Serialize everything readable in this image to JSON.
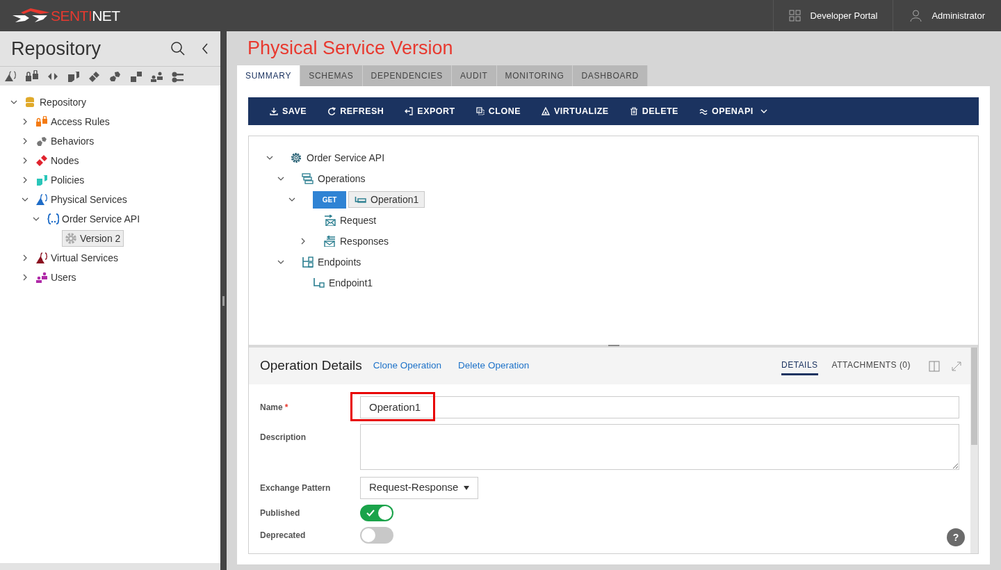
{
  "header": {
    "logo": [
      {
        "text": "SENTI",
        "color": "#e8392f"
      },
      {
        "text": "NET",
        "color": "#ffffff"
      }
    ],
    "links": [
      "Developer Portal",
      "Administrator"
    ]
  },
  "sidebar": {
    "title": "Repository",
    "tree": [
      {
        "label": "Repository",
        "kind": "database",
        "expanded": true,
        "selected": false,
        "children": [
          {
            "label": "Access Rules",
            "kind": "locks",
            "expanded": false,
            "selected": false
          },
          {
            "label": "Behaviors",
            "kind": "hexes",
            "expanded": false,
            "selected": false
          },
          {
            "label": "Nodes",
            "kind": "diamonds",
            "expanded": false,
            "selected": false
          },
          {
            "label": "Policies",
            "kind": "squares",
            "expanded": false,
            "selected": false
          },
          {
            "label": "Physical Services",
            "kind": "physical",
            "expanded": true,
            "selected": false,
            "children": [
              {
                "label": "Order Service API",
                "kind": "braces",
                "expanded": true,
                "selected": false,
                "children": [
                  {
                    "label": "Version 2",
                    "kind": "gear",
                    "selected": true
                  }
                ]
              }
            ]
          },
          {
            "label": "Virtual Services",
            "kind": "virtual",
            "expanded": false,
            "selected": false
          },
          {
            "label": "Users",
            "kind": "users",
            "expanded": false,
            "selected": false
          }
        ]
      }
    ]
  },
  "main": {
    "title": "Physical Service Version",
    "tabs": [
      {
        "label": "SUMMARY",
        "selected": true
      },
      {
        "label": "SCHEMAS",
        "selected": false
      },
      {
        "label": "DEPENDENCIES",
        "selected": false
      },
      {
        "label": "AUDIT",
        "selected": false
      },
      {
        "label": "MONITORING",
        "selected": false
      },
      {
        "label": "DASHBOARD",
        "selected": false
      }
    ],
    "toolbar": [
      {
        "label": "SAVE",
        "kind": "download"
      },
      {
        "label": "REFRESH",
        "kind": "refresh"
      },
      {
        "label": "EXPORT",
        "kind": "export"
      },
      {
        "label": "CLONE",
        "kind": "clone"
      },
      {
        "label": "VIRTUALIZE",
        "kind": "triangle"
      },
      {
        "label": "DELETE",
        "kind": "trash"
      },
      {
        "label": "OPENAPI",
        "kind": "approx",
        "dropdown": true
      }
    ],
    "tree": [
      {
        "label": "Order Service API",
        "kind": "gear",
        "expanded": true,
        "children": [
          {
            "label": "Operations",
            "kind": "operations",
            "expanded": true,
            "children": [
              {
                "label": "Operation1",
                "kind": "operation",
                "method": "GET",
                "expanded": true,
                "selected": true,
                "children": [
                  {
                    "label": "Request",
                    "kind": "request"
                  },
                  {
                    "label": "Responses",
                    "kind": "responses",
                    "expanded": false
                  }
                ]
              }
            ]
          },
          {
            "label": "Endpoints",
            "kind": "endpoints",
            "expanded": true,
            "children": [
              {
                "label": "Endpoint1",
                "kind": "endpoint"
              }
            ]
          }
        ]
      }
    ],
    "details": {
      "title": "Operation Details",
      "links": [
        "Clone Operation",
        "Delete Operation"
      ],
      "tabs": [
        {
          "label": "DETAILS",
          "selected": true
        },
        {
          "label": "ATTACHMENTS (0)",
          "selected": false
        }
      ],
      "fields": [
        {
          "label": "Name",
          "required_mark": "*",
          "kind": "text",
          "value": "Operation1",
          "highlighted": true
        },
        {
          "label": "Description",
          "kind": "textarea"
        },
        {
          "label": "Exchange Pattern",
          "kind": "select",
          "value": "Request-Response"
        },
        {
          "label": "Published",
          "kind": "toggle",
          "on": true
        },
        {
          "label": "Deprecated",
          "kind": "toggle",
          "on": false
        }
      ],
      "help": "?"
    }
  }
}
